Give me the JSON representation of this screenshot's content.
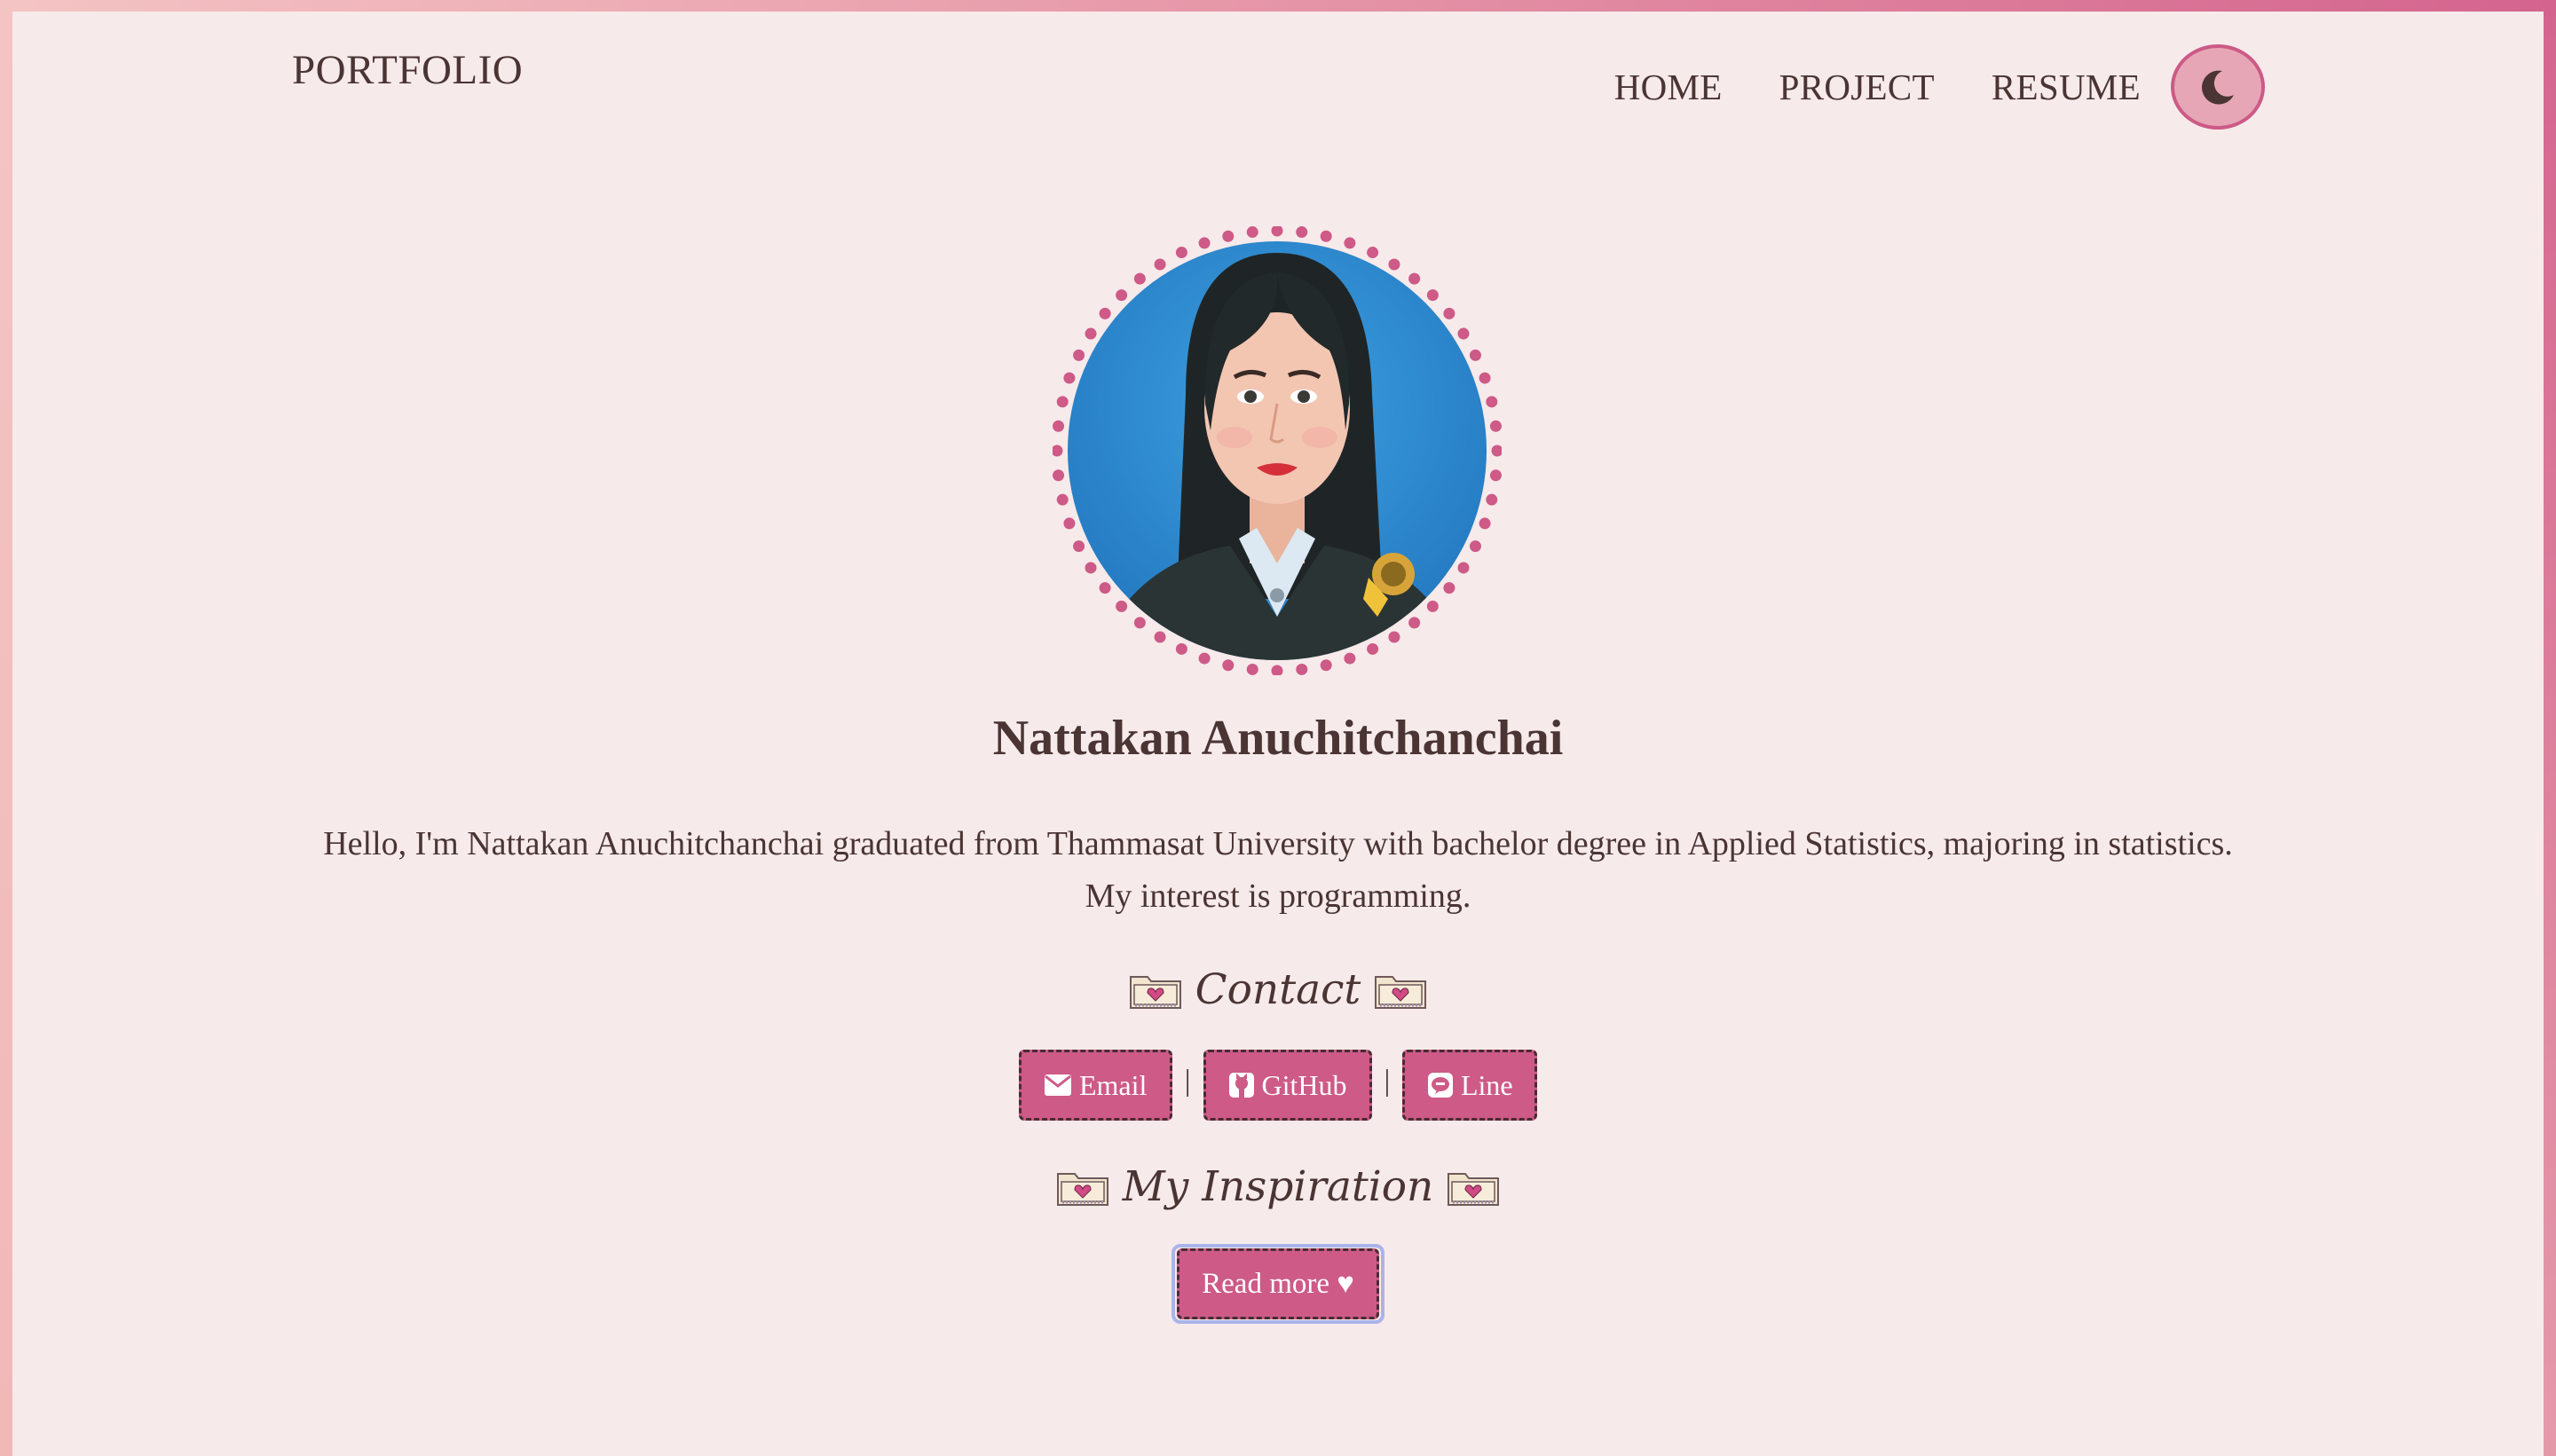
{
  "nav": {
    "brand": "PORTFOLIO",
    "items": [
      {
        "label": "HOME"
      },
      {
        "label": "PROJECT"
      },
      {
        "label": "RESUME"
      }
    ],
    "theme_toggle_icon": "moon-icon"
  },
  "profile": {
    "avatar_icon": "profile-portrait",
    "name": "Nattakan Anuchitchanchai",
    "bio": "Hello, I'm Nattakan Anuchitchanchai graduated from Thammasat University with bachelor degree in Applied Statistics, majoring in statistics. My interest is programming."
  },
  "contact": {
    "title": "Contact",
    "separator": "|",
    "buttons": [
      {
        "label": "Email",
        "icon": "envelope-icon"
      },
      {
        "label": "GitHub",
        "icon": "github-icon"
      },
      {
        "label": "Line",
        "icon": "line-icon"
      }
    ]
  },
  "inspiration": {
    "title": "My Inspiration",
    "button_label": "Read more ♥"
  },
  "colors": {
    "background": "#f7eaea",
    "accent": "#cd5a87",
    "text": "#4a3434"
  }
}
